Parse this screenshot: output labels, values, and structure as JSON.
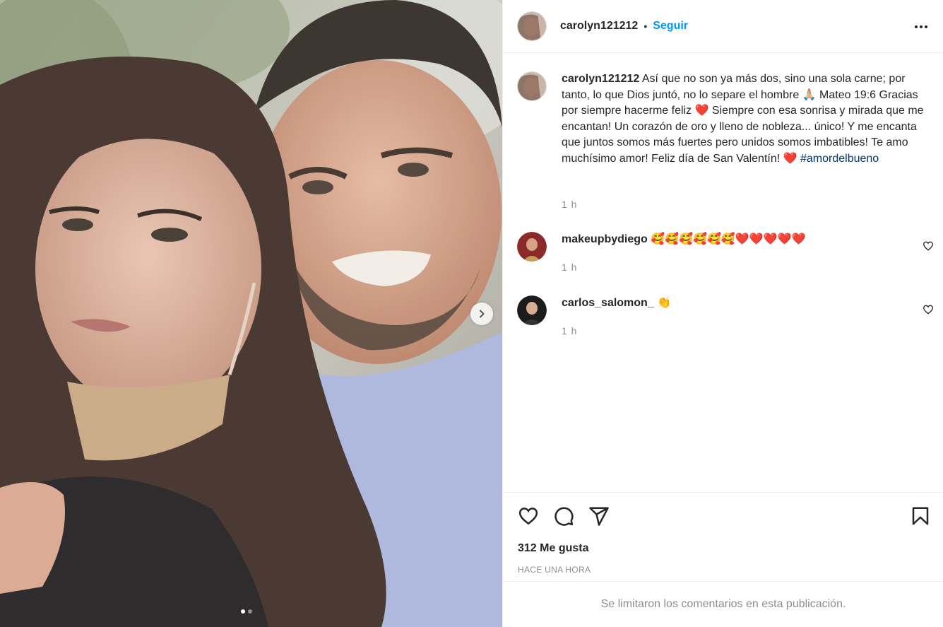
{
  "post": {
    "author": "carolyn121212",
    "separator": "•",
    "follow_label": "Seguir",
    "more_options_icon": "more-horizontal-icon",
    "caption": {
      "username": "carolyn121212",
      "text_1": "Así que no son ya más dos, sino una sola carne; por tanto, lo que Dios juntó, no lo separe el hombre ",
      "emoji_1": "🙏🏼",
      "text_2": " Mateo 19:6 Gracias por siempre hacerme feliz ",
      "emoji_2": "❤️",
      "text_3": " Siempre con esa sonrisa y mirada que me encantan! Un corazón de oro y lleno de nobleza... único! Y me encanta que juntos somos más fuertes pero unidos somos imbatibles! Te amo muchísimo amor! Feliz día de San Valentín! ",
      "emoji_3": "❤️",
      "hashtag": "#amordelbueno",
      "time": "1 h"
    },
    "comments": [
      {
        "username": "makeupbydiego",
        "text": "🥰🥰🥰🥰🥰🥰❤️❤️❤️❤️❤️",
        "time": "1 h",
        "like_icon": "heart-outline-icon"
      },
      {
        "username": "carlos_salomon_",
        "text": "👏",
        "time": "1 h",
        "like_icon": "heart-outline-icon"
      }
    ],
    "actions": {
      "like_icon": "heart-icon",
      "comment_icon": "comment-icon",
      "share_icon": "send-icon",
      "save_icon": "bookmark-icon"
    },
    "likes_text": "312 Me gusta",
    "posted_text": "HACE UNA HORA",
    "comments_limited_text": "Se limitaron los comentarios en esta publicación.",
    "carousel": {
      "current": 1,
      "total": 2,
      "next_icon": "chevron-right-icon"
    }
  },
  "colors": {
    "follow": "#0095f6",
    "hashtag": "#00376b",
    "muted": "#8e8e8e",
    "text": "#262626",
    "border": "#efefef"
  }
}
